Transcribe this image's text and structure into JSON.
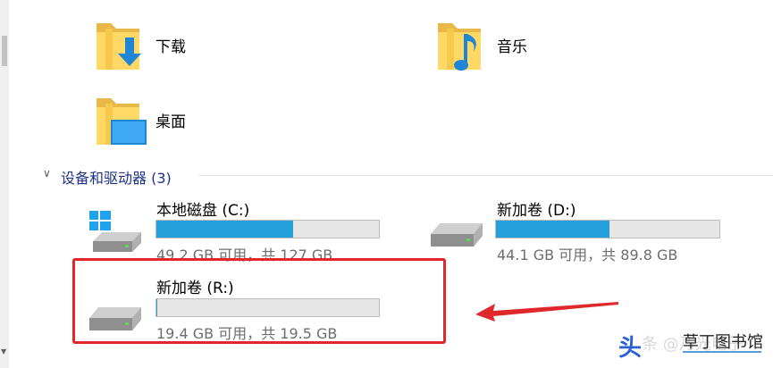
{
  "folders": [
    {
      "name": "下载",
      "icon": "downloads-folder-icon"
    },
    {
      "name": "音乐",
      "icon": "music-folder-icon"
    },
    {
      "name": "桌面",
      "icon": "desktop-folder-icon"
    }
  ],
  "devices_section": {
    "title": "设备和驱动器 (3)",
    "expanded": true
  },
  "drives": [
    {
      "name": "本地磁盘 (C:)",
      "info": "49.2 GB 可用，共 127 GB",
      "used_fraction": 0.613,
      "icon": "windows-drive-icon"
    },
    {
      "name": "新加卷 (D:)",
      "info": "44.1 GB 可用，共 89.8 GB",
      "used_fraction": 0.509,
      "icon": "drive-icon"
    },
    {
      "name": "新加卷 (R:)",
      "info": "19.4 GB 可用，共 19.5 GB",
      "used_fraction": 0.005,
      "icon": "drive-icon"
    }
  ],
  "annotation": {
    "highlight_color": "#e0272b"
  },
  "watermark": {
    "logo": "头",
    "text": "条 @乃光电子",
    "text_overlay": "草丁图书馆"
  },
  "colors": {
    "bar_fill": "#26a0da",
    "bar_bg": "#e6e6e6",
    "section_title": "#1e3287"
  }
}
